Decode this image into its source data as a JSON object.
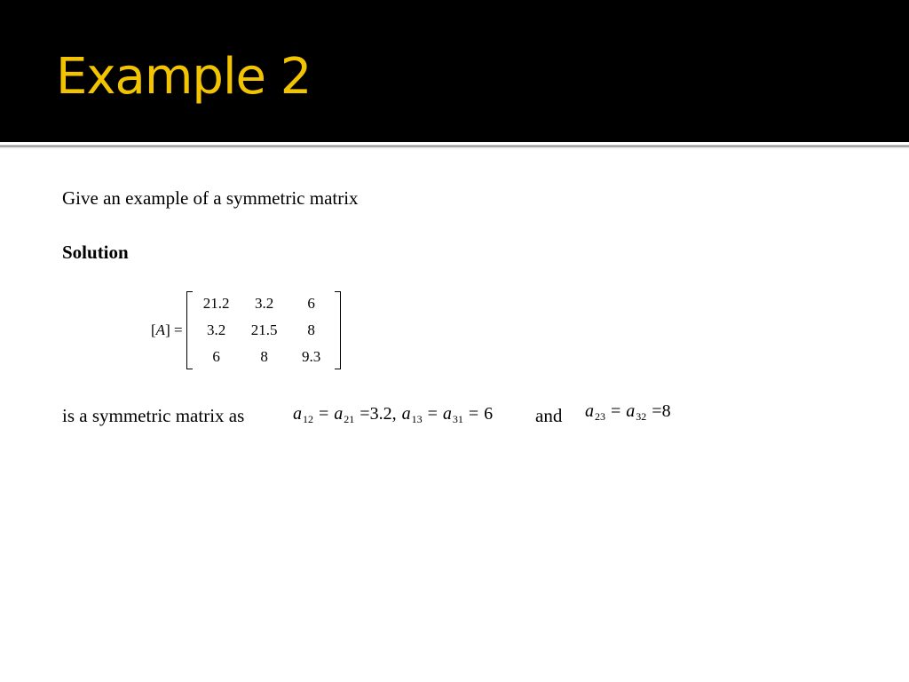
{
  "slide": {
    "title": "Example 2",
    "colors": {
      "title_band": "#000000",
      "title_text": "#f2c300"
    }
  },
  "content": {
    "question": "Give an example of a symmetric matrix",
    "solution_label": "Solution",
    "matrix": {
      "lhs_open": "[",
      "lhs_name": "A",
      "lhs_close": "] =",
      "rows": [
        [
          "21.2",
          "3.2",
          "6"
        ],
        [
          "3.2",
          "21.5",
          "8"
        ],
        [
          "6",
          "8",
          "9.3"
        ]
      ]
    },
    "statement": "is a symmetric matrix as",
    "equations": {
      "eq1": {
        "a12": {
          "base": "a",
          "sub": "12"
        },
        "eqsign": "=",
        "a21": {
          "base": "a",
          "sub": "21"
        },
        "val1": "3.2,",
        "a13": {
          "base": "a",
          "sub": "13"
        },
        "a31": {
          "base": "a",
          "sub": "31"
        },
        "val2": "6"
      },
      "and_word": "and",
      "eq2": {
        "a23": {
          "base": "a",
          "sub": "23"
        },
        "eqsign": "=",
        "a32": {
          "base": "a",
          "sub": "32"
        },
        "val": "8"
      }
    }
  }
}
